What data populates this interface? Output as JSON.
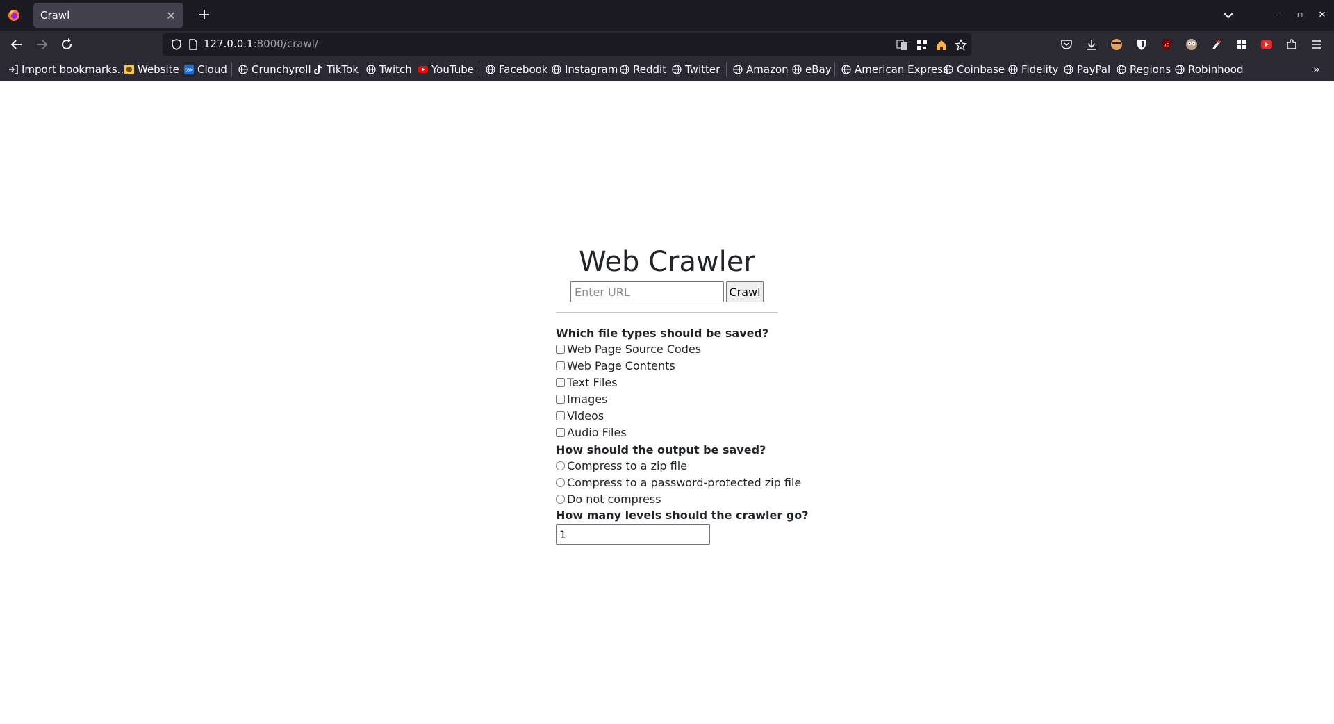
{
  "browser": {
    "tab": {
      "title": "Crawl"
    },
    "url": {
      "host": "127.0.0.1",
      "rest": ":8000/crawl/"
    },
    "bookmarks": [
      {
        "label": "Import bookmarks...",
        "icon": "import-icon"
      },
      {
        "label": "Website",
        "icon": "website-icon"
      },
      {
        "label": "Cloud",
        "icon": "dsm-icon"
      },
      {
        "label": "Crunchyroll",
        "icon": "globe-icon"
      },
      {
        "label": "TikTok",
        "icon": "tiktok-icon"
      },
      {
        "label": "Twitch",
        "icon": "globe-icon"
      },
      {
        "label": "YouTube",
        "icon": "youtube-icon"
      },
      {
        "label": "Facebook",
        "icon": "globe-icon"
      },
      {
        "label": "Instagram",
        "icon": "globe-icon"
      },
      {
        "label": "Reddit",
        "icon": "globe-icon"
      },
      {
        "label": "Twitter",
        "icon": "globe-icon"
      },
      {
        "label": "Amazon",
        "icon": "globe-icon"
      },
      {
        "label": "eBay",
        "icon": "globe-icon"
      },
      {
        "label": "American Express",
        "icon": "globe-icon"
      },
      {
        "label": "Coinbase",
        "icon": "globe-icon"
      },
      {
        "label": "Fidelity",
        "icon": "globe-icon"
      },
      {
        "label": "PayPal",
        "icon": "globe-icon"
      },
      {
        "label": "Regions",
        "icon": "globe-icon"
      },
      {
        "label": "Robinhood",
        "icon": "globe-icon"
      }
    ]
  },
  "page": {
    "title": "Web Crawler",
    "url_input": {
      "placeholder": "Enter URL",
      "value": ""
    },
    "crawl_button": "Crawl",
    "file_types": {
      "question": "Which file types should be saved?",
      "options": [
        "Web Page Source Codes",
        "Web Page Contents",
        "Text Files",
        "Images",
        "Videos",
        "Audio Files"
      ]
    },
    "output": {
      "question": "How should the output be saved?",
      "options": [
        "Compress to a zip file",
        "Compress to a password-protected zip file",
        "Do not compress"
      ]
    },
    "levels": {
      "question": "How many levels should the crawler go?",
      "value": "1"
    }
  }
}
